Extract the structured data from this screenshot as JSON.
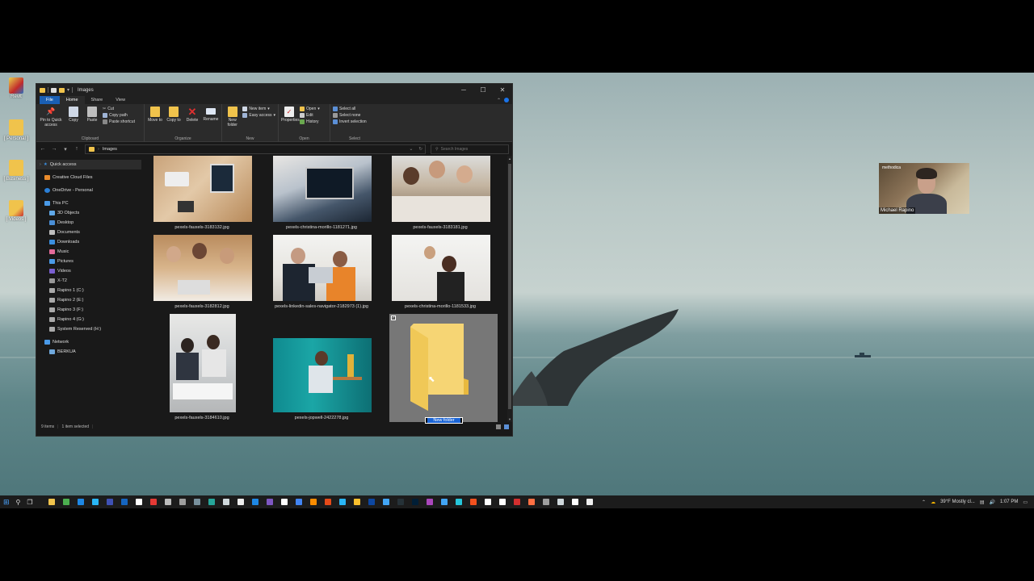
{
  "desktop": {
    "icons": [
      {
        "label": "Revit"
      },
      {
        "label": "[ Personal ]"
      },
      {
        "label": "[ Business ]"
      },
      {
        "label": "[ Videos ]"
      }
    ]
  },
  "webcam": {
    "name": "Michael Rapino",
    "brand": "methodica"
  },
  "explorer": {
    "title": "Images",
    "window_controls": {
      "minimize": "─",
      "maximize": "☐",
      "close": "✕"
    },
    "tabs": [
      "File",
      "Home",
      "Share",
      "View"
    ],
    "ribbon": {
      "clipboard": {
        "name": "Clipboard",
        "pin": "Pin to Quick access",
        "copy": "Copy",
        "paste": "Paste",
        "cut": "Cut",
        "copy_path": "Copy path",
        "paste_shortcut": "Paste shortcut"
      },
      "organize": {
        "name": "Organize",
        "move_to": "Move to",
        "copy_to": "Copy to",
        "delete": "Delete",
        "rename": "Rename"
      },
      "new": {
        "name": "New",
        "new_folder": "New folder",
        "new_item": "New item",
        "easy_access": "Easy access"
      },
      "open": {
        "name": "Open",
        "properties": "Properties",
        "open": "Open",
        "edit": "Edit",
        "history": "History"
      },
      "select": {
        "name": "Select",
        "select_all": "Select all",
        "select_none": "Select none",
        "invert": "Invert selection"
      }
    },
    "address": {
      "path": "Images",
      "search_placeholder": "Search Images"
    },
    "nav": {
      "quick_access": "Quick access",
      "creative_cloud": "Creative Cloud Files",
      "onedrive": "OneDrive - Personal",
      "this_pc": "This PC",
      "pc_items": [
        "3D Objects",
        "Desktop",
        "Documents",
        "Downloads",
        "Music",
        "Pictures",
        "Videos",
        "X-T2",
        "Rapino 1 (C:)",
        "Rapino 2 (E:)",
        "Rapino 3 (F:)",
        "Rapino 4 (G:)",
        "System Reserved (H:)"
      ],
      "network": "Network",
      "network_items": [
        "BERKUA"
      ]
    },
    "files": [
      {
        "name": "pexels-fauxels-3183132.jpg"
      },
      {
        "name": "pexels-christina-morillo-1181271.jpg"
      },
      {
        "name": "pexels-fauxels-3183181.jpg"
      },
      {
        "name": "pexels-fauxels-3182812.jpg"
      },
      {
        "name": "pexels-linkedin-sales-navigator-2182973 (1).jpg"
      },
      {
        "name": "pexels-christina-morillo-1181533.jpg"
      },
      {
        "name": "pexels-fauxels-3184610.jpg"
      },
      {
        "name": "pexels-jopwell-2422278.jpg"
      },
      {
        "name": "New folder"
      }
    ],
    "status": {
      "count": "9 items",
      "selected": "1 item selected"
    }
  },
  "taskbar": {
    "weather": "39°F  Mostly cl...",
    "time": "1:07 PM"
  },
  "colors": {
    "accent": "#1a5fb4",
    "folder": "#f0c34c",
    "selection": "#777777"
  }
}
